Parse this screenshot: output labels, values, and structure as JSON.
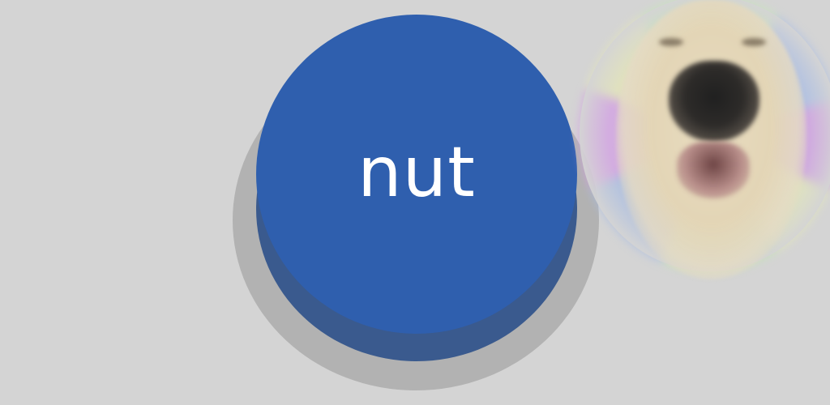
{
  "button": {
    "label": "nut",
    "cap_color": "#2f5fae",
    "side_color": "#3a5a8e",
    "base_color": "#b2b2b2"
  },
  "background": {
    "color": "#d4d4d4"
  },
  "decoration": {
    "image": "dog-face-image"
  }
}
